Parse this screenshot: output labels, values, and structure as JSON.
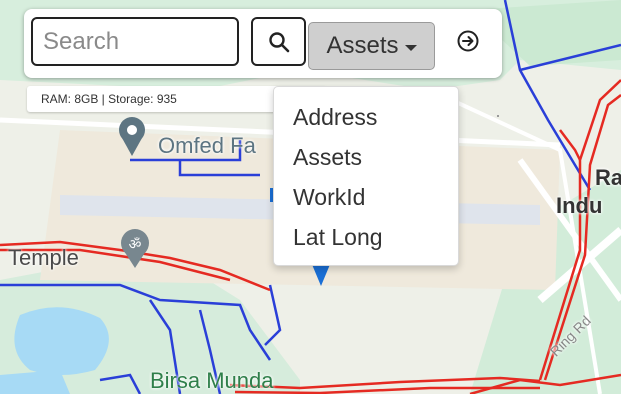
{
  "search": {
    "placeholder": "Search"
  },
  "assets_dropdown": {
    "label": "Assets",
    "options": [
      "Address",
      "Assets",
      "WorkId",
      "Lat Long"
    ]
  },
  "status": {
    "text": "RAM: 8GB |  Storage:  935"
  },
  "map": {
    "labels": {
      "omfed": "Omfed Fa",
      "temple": "Temple",
      "birsa": "Birsa Munda",
      "ra": "Ra",
      "indu": "Indu",
      "ring_rd": "Ring Rd"
    }
  },
  "icons": {
    "search": "search-icon",
    "go": "arrow-right-circle-icon",
    "caret": "caret-down-icon"
  },
  "colors": {
    "map_bg": "#eef0e8",
    "blue_route": "#2a3fd8",
    "red_route": "#e52a22",
    "water": "#a7daf5",
    "park": "#cdebd5",
    "pin": "#5d7582"
  }
}
